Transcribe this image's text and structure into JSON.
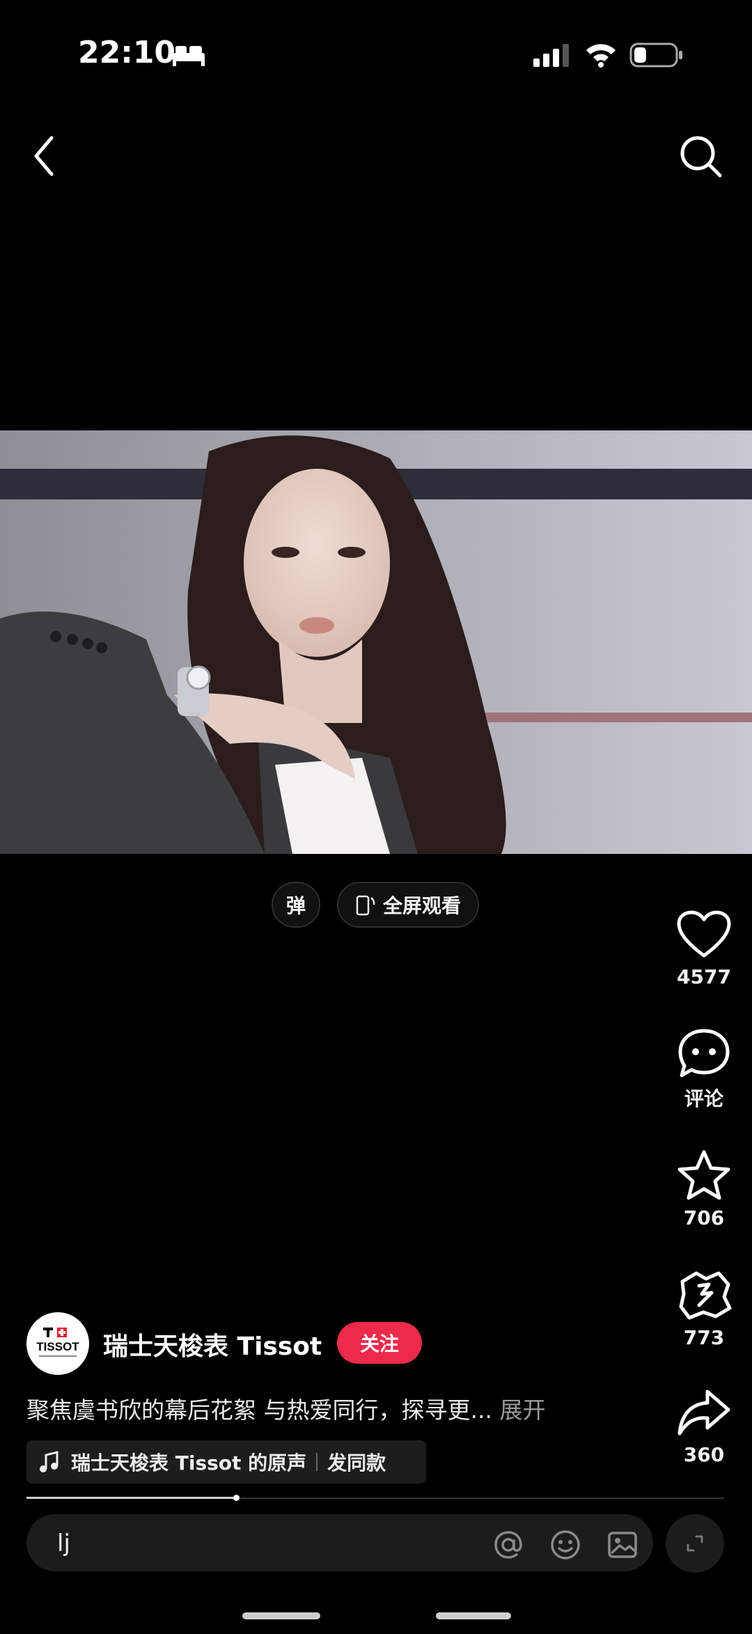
{
  "status_bar": {
    "time": "22:10",
    "battery_level": 0.3
  },
  "video": {
    "danmaku_label": "弹",
    "fullscreen_label": "全屏观看"
  },
  "actions": {
    "like_count": "4577",
    "comment_label": "评论",
    "favorite_count": "706",
    "share_alt_count": "773",
    "share_count": "360"
  },
  "author": {
    "name": "瑞士天梭表 Tissot",
    "follow_label": "关注",
    "avatar_text": "TISSOT"
  },
  "caption": {
    "text": "聚焦虞书欣的幕后花絮 与热爱同行，探寻更...",
    "expand_label": "展开"
  },
  "music": {
    "title": "瑞士天梭表 Tissot 的原声",
    "use_label": "发同款"
  },
  "playback": {
    "progress": 0.3
  },
  "comment_input": {
    "value": "lj"
  },
  "colors": {
    "follow": "#ee2a4b",
    "background": "#000000"
  }
}
